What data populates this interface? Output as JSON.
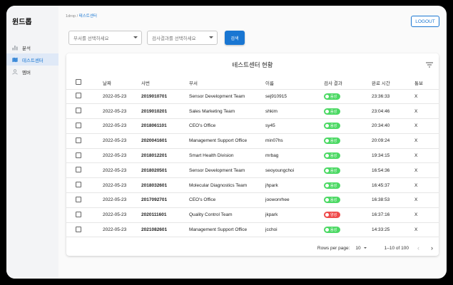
{
  "app": {
    "brand": "윈드롭"
  },
  "sidebar": {
    "items": [
      {
        "label": "분석",
        "icon": "bar-chart-icon",
        "active": false
      },
      {
        "label": "테스트센터",
        "icon": "map-icon",
        "active": true
      },
      {
        "label": "멤버",
        "icon": "person-icon",
        "active": false
      }
    ]
  },
  "header": {
    "breadcrumb_root": "1drop",
    "breadcrumb_sep": " / ",
    "breadcrumb_current": "테스트센터",
    "logout_label": "LOGOUT"
  },
  "filters": {
    "department_placeholder": "부서를 선택하세요",
    "result_placeholder": "검사결과를 선택하세요",
    "search_label": "검색"
  },
  "table": {
    "title": "테스트센터 현황",
    "columns": [
      "날짜",
      "사번",
      "부서",
      "이름",
      "검사 결과",
      "완료 시간",
      "통보"
    ],
    "rows": [
      {
        "date": "2022-05-23",
        "id": "2019010701",
        "dept": "Sensor Development Team",
        "name": "sej910915",
        "result": "음성",
        "status": "negative",
        "time": "23:36:33",
        "notify": "X"
      },
      {
        "date": "2022-05-23",
        "id": "2019010201",
        "dept": "Sales Marketing Team",
        "name": "shkim",
        "result": "음성",
        "status": "negative",
        "time": "23:04:46",
        "notify": "X"
      },
      {
        "date": "2022-05-23",
        "id": "2018061101",
        "dept": "CEO's Office",
        "name": "sy45",
        "result": "음성",
        "status": "negative",
        "time": "20:34:40",
        "notify": "X"
      },
      {
        "date": "2022-05-23",
        "id": "2020041601",
        "dept": "Management Support Office",
        "name": "min07hs",
        "result": "음성",
        "status": "negative",
        "time": "20:09:24",
        "notify": "X"
      },
      {
        "date": "2022-05-23",
        "id": "2018012201",
        "dept": "Smart Health Division",
        "name": "mrbag",
        "result": "음성",
        "status": "negative",
        "time": "19:34:15",
        "notify": "X"
      },
      {
        "date": "2022-05-23",
        "id": "2018020501",
        "dept": "Sensor Development Team",
        "name": "seoyoungchoi",
        "result": "음성",
        "status": "negative",
        "time": "16:54:36",
        "notify": "X"
      },
      {
        "date": "2022-05-23",
        "id": "2018032601",
        "dept": "Molecular Diagnostics Team",
        "name": "jhpark",
        "result": "음성",
        "status": "negative",
        "time": "16:45:37",
        "notify": "X"
      },
      {
        "date": "2022-05-23",
        "id": "2017092701",
        "dept": "CEO's Office",
        "name": "joowonrhee",
        "result": "음성",
        "status": "negative",
        "time": "16:38:53",
        "notify": "X"
      },
      {
        "date": "2022-05-23",
        "id": "2020111601",
        "dept": "Quality Control Team",
        "name": "jkpark",
        "result": "양성",
        "status": "positive",
        "time": "16:37:16",
        "notify": "X"
      },
      {
        "date": "2022-05-23",
        "id": "2021082601",
        "dept": "Management Support Office",
        "name": "jcchoi",
        "result": "음성",
        "status": "negative",
        "time": "14:33:25",
        "notify": "X"
      }
    ]
  },
  "pagination": {
    "rows_per_page_label": "Rows per page:",
    "rows_per_page": "10",
    "range": "1–10 of 100"
  },
  "colors": {
    "accent": "#1976d2",
    "negative": "#4cd964",
    "positive": "#ef4b4b"
  }
}
